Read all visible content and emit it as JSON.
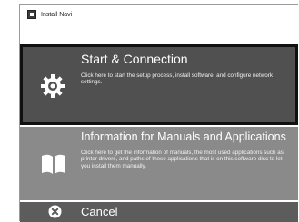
{
  "window": {
    "title": "Install Navi",
    "icon": "app-icon"
  },
  "menu": {
    "start": {
      "title": "Start & Connection",
      "description": "Click here to start the setup process, install software, and configure network settings.",
      "icon": "gear-icon",
      "selected": true
    },
    "info": {
      "title": "Information for Manuals and Applications",
      "description": "Click here to get the information of manuals, the most used applications such as printer drivers, and paths of these applications that is on this software disc to let you install them manually.",
      "icon": "book-icon"
    },
    "cancel": {
      "title": "Cancel",
      "icon": "close-circle-icon"
    }
  },
  "colors": {
    "start_bg": "#505050",
    "info_bg": "#8a8a8a",
    "cancel_bg": "#5c5c5c",
    "selection_border": "#111111"
  }
}
